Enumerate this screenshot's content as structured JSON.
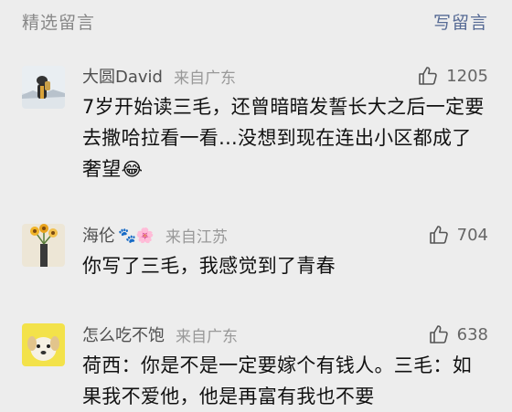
{
  "header": {
    "title": "精选留言",
    "write_label": "写留言"
  },
  "comments": [
    {
      "nickname": "大圆David",
      "nickname_emoji": "",
      "location": "来自广东",
      "likes": "1205",
      "text": "7岁开始读三毛，还曾暗暗发誓长大之后一定要去撒哈拉看一看...没想到现在连出小区都成了奢望",
      "trailing_emoji": "😂"
    },
    {
      "nickname": "海伦",
      "nickname_emoji": "🐾🌸",
      "location": "来自江苏",
      "likes": "704",
      "text": "你写了三毛，我感觉到了青春",
      "trailing_emoji": ""
    },
    {
      "nickname": "怎么吃不饱",
      "nickname_emoji": "",
      "location": "来自广东",
      "likes": "638",
      "text": "荷西：你是不是一定要嫁个有钱人。三毛：如果我不爱他，他是再富有我也不要",
      "trailing_emoji": ""
    }
  ],
  "colors": {
    "background": "#ededed",
    "link": "#576b95",
    "meta": "#999999"
  }
}
